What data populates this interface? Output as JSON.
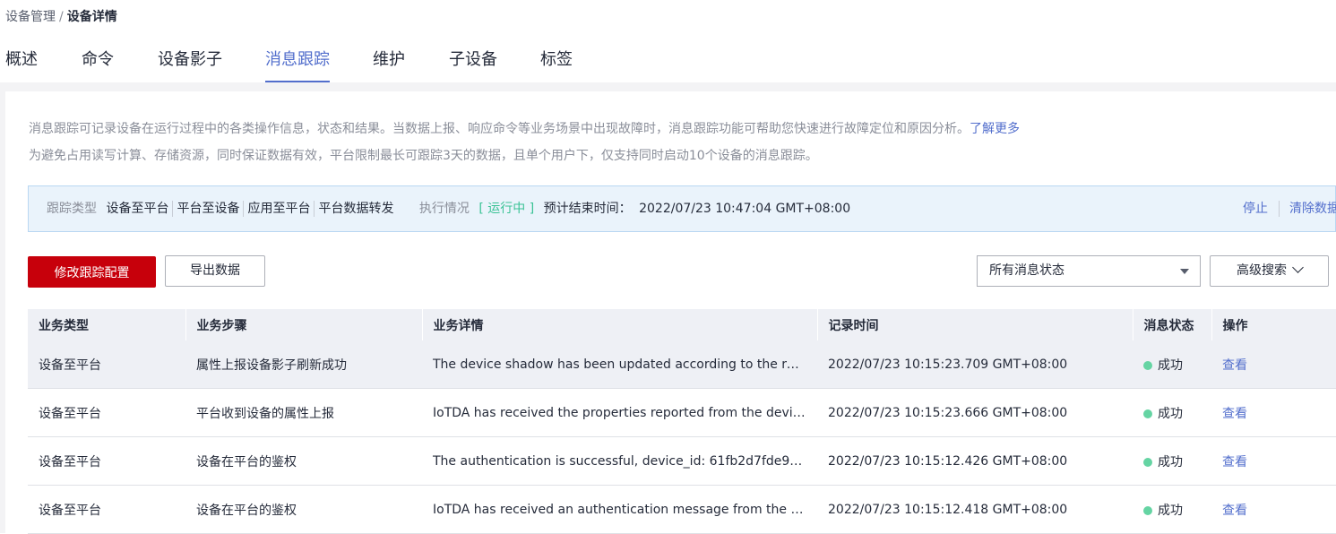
{
  "breadcrumb": {
    "parent": "设备管理",
    "separator": "/",
    "current": "设备详情"
  },
  "tabs": [
    {
      "label": "概述"
    },
    {
      "label": "命令"
    },
    {
      "label": "设备影子"
    },
    {
      "label": "消息跟踪",
      "active": true
    },
    {
      "label": "维护"
    },
    {
      "label": "子设备"
    },
    {
      "label": "标签"
    }
  ],
  "description": {
    "line1": "消息跟踪可记录设备在运行过程中的各类操作信息，状态和结果。当数据上报、响应命令等业务场景中出现故障时，消息跟踪功能可帮助您快速进行故障定位和原因分析。",
    "learn_more": "了解更多",
    "line2": "为避免占用读写计算、存储资源，同时保证数据有效，平台限制最长可跟踪3天的数据，且单个用户下，仅支持同时启动10个设备的消息跟踪。"
  },
  "trace_info": {
    "type_label": "跟踪类型",
    "types": [
      "设备至平台",
      "平台至设备",
      "应用至平台",
      "平台数据转发"
    ],
    "exec_label": "执行情况",
    "exec_status": "[ 运行中 ]",
    "end_time_label": "预计结束时间：",
    "end_time": "2022/07/23 10:47:04 GMT+08:00",
    "stop": "停止",
    "clear": "清除数据"
  },
  "toolbar": {
    "modify_button": "修改跟踪配置",
    "export_button": "导出数据",
    "status_filter": "所有消息状态",
    "advanced_search": "高级搜索"
  },
  "table": {
    "headers": [
      "业务类型",
      "业务步骤",
      "业务详情",
      "记录时间",
      "消息状态",
      "操作"
    ],
    "rows": [
      {
        "type": "设备至平台",
        "step": "属性上报设备影子刷新成功",
        "detail": "The device shadow has been updated according to the reported properties.",
        "time": "2022/07/23 10:15:23.709 GMT+08:00",
        "status": "成功",
        "action": "查看"
      },
      {
        "type": "设备至平台",
        "step": "平台收到设备的属性上报",
        "detail": "IoTDA has received the properties reported from the device.",
        "time": "2022/07/23 10:15:23.666 GMT+08:00",
        "status": "成功",
        "action": "查看"
      },
      {
        "type": "设备至平台",
        "step": "设备在平台的鉴权",
        "detail": "The authentication is successful, device_id: 61fb2d7fde993...",
        "time": "2022/07/23 10:15:12.426 GMT+08:00",
        "status": "成功",
        "action": "查看"
      },
      {
        "type": "设备至平台",
        "step": "设备在平台的鉴权",
        "detail": "IoTDA has received an authentication message from the device.",
        "time": "2022/07/23 10:15:12.418 GMT+08:00",
        "status": "成功",
        "action": "查看"
      }
    ]
  },
  "colors": {
    "accent": "#526ecc",
    "primary_button": "#c7000b",
    "running": "#3ac295",
    "success_dot": "#65d4a3",
    "info_bg": "#eaf3fb"
  }
}
